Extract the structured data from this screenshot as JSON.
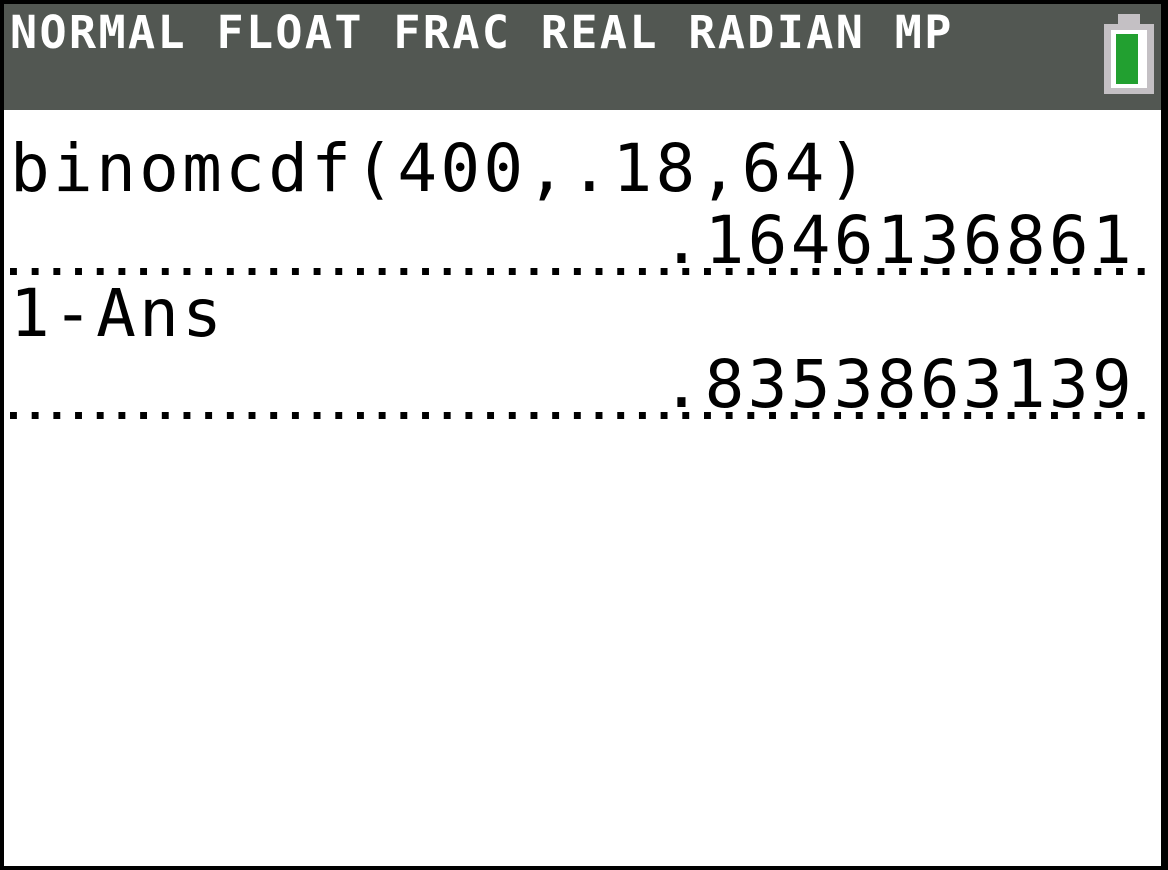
{
  "status_bar": {
    "modes": "NORMAL FLOAT FRAC REAL RADIAN MP",
    "battery_icon": "battery-full-icon",
    "battery_color": "#22a030",
    "background": "#525752"
  },
  "history": [
    {
      "input": "binomcdf(400,.18,64)",
      "result": ".1646136861"
    },
    {
      "input": "1-Ans",
      "result": ".8353863139"
    }
  ]
}
